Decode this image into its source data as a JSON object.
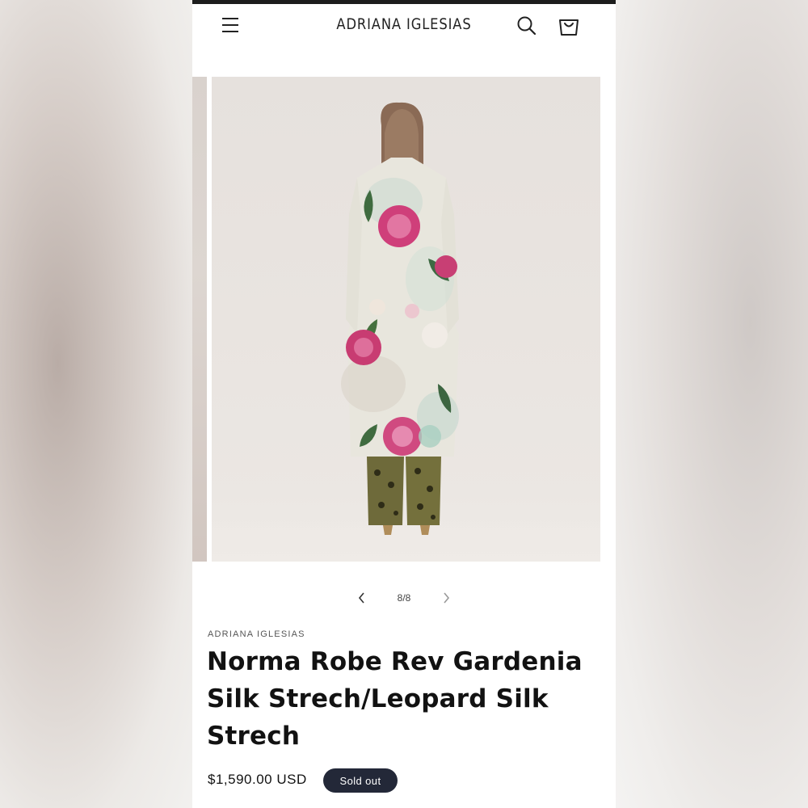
{
  "header": {
    "logo": "ADRIANA IGLESIAS",
    "icons": [
      "menu-icon",
      "search-icon",
      "cart-icon"
    ]
  },
  "gallery": {
    "counter": "8/8",
    "prev_icon": "chevron-left-icon",
    "next_icon": "chevron-right-icon"
  },
  "product": {
    "vendor": "ADRIANA IGLESIAS",
    "title": "Norma Robe Rev Gardenia Silk Strech/Leopard Silk Strech",
    "price": "$1,590.00 USD",
    "badge": "Sold out"
  },
  "colors": {
    "badge_bg": "#232838",
    "text": "#121212",
    "accent_pink": "#d0407a"
  }
}
